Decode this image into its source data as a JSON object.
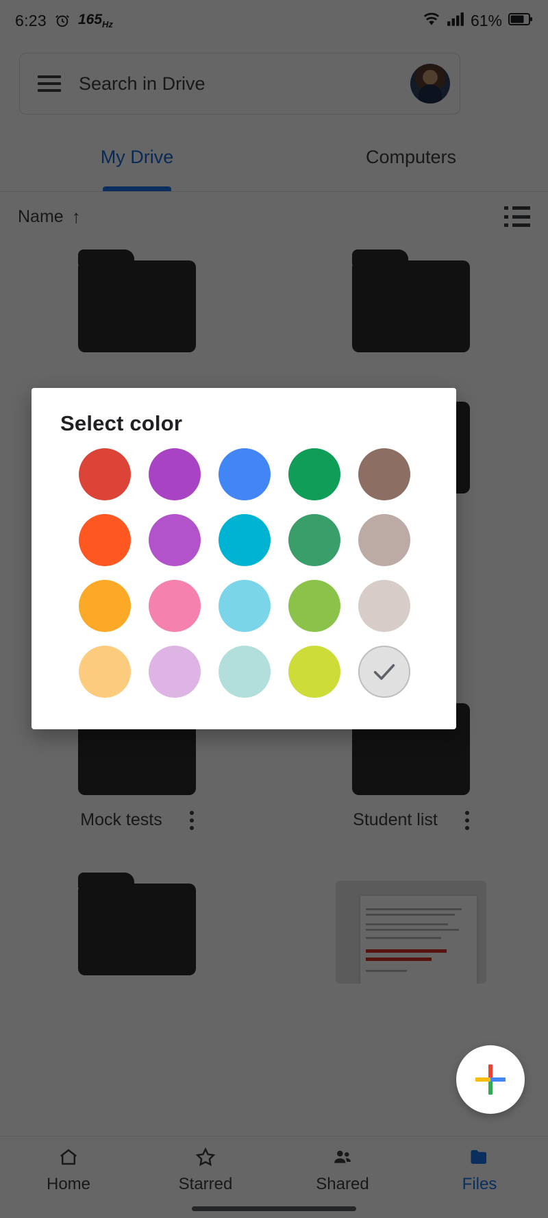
{
  "statusbar": {
    "time": "6:23",
    "refresh_rate": "165",
    "refresh_unit": "Hz",
    "battery_percent": "61%",
    "icons": [
      "alarm-icon",
      "wifi-icon",
      "signal-icon",
      "battery-icon"
    ]
  },
  "search": {
    "placeholder": "Search in Drive",
    "menu_icon": "hamburger-menu-icon",
    "avatar": "user-avatar"
  },
  "tabs": [
    {
      "label": "My Drive",
      "active": true
    },
    {
      "label": "Computers",
      "active": false
    }
  ],
  "sort": {
    "label": "Name",
    "direction_arrow": "↑",
    "view_toggle_icon": "list-view-icon"
  },
  "files": {
    "row2": [
      {
        "name": "Mock tests",
        "type": "folder"
      },
      {
        "name": "Student list",
        "type": "folder"
      }
    ]
  },
  "fab": {
    "label": "new-button",
    "icon": "google-plus-icon"
  },
  "bottomnav": [
    {
      "label": "Home",
      "icon": "home-icon",
      "active": false
    },
    {
      "label": "Starred",
      "icon": "star-icon",
      "active": false
    },
    {
      "label": "Shared",
      "icon": "people-icon",
      "active": false
    },
    {
      "label": "Files",
      "icon": "folder-icon",
      "active": true
    }
  ],
  "dialog": {
    "title": "Select color",
    "colors": [
      [
        {
          "name": "red",
          "hex": "#DB4437",
          "selected": false
        },
        {
          "name": "purple",
          "hex": "#A843C4",
          "selected": false
        },
        {
          "name": "blue",
          "hex": "#4285F4",
          "selected": false
        },
        {
          "name": "green",
          "hex": "#0F9D58",
          "selected": false
        },
        {
          "name": "brown",
          "hex": "#8D6E63",
          "selected": false
        }
      ],
      [
        {
          "name": "orange",
          "hex": "#FF5722",
          "selected": false
        },
        {
          "name": "light-purple",
          "hex": "#B253CC",
          "selected": false
        },
        {
          "name": "cyan",
          "hex": "#00B3D3",
          "selected": false
        },
        {
          "name": "medium-green",
          "hex": "#3A9E6A",
          "selected": false
        },
        {
          "name": "light-brown",
          "hex": "#BCAAA4",
          "selected": false
        }
      ],
      [
        {
          "name": "amber",
          "hex": "#FBA926",
          "selected": false
        },
        {
          "name": "pink",
          "hex": "#F582AE",
          "selected": false
        },
        {
          "name": "light-blue",
          "hex": "#7BD5E8",
          "selected": false
        },
        {
          "name": "light-green",
          "hex": "#8BC34A",
          "selected": false
        },
        {
          "name": "pale-brown",
          "hex": "#D7CCC8",
          "selected": false
        }
      ],
      [
        {
          "name": "pale-amber",
          "hex": "#FCCB7E",
          "selected": false
        },
        {
          "name": "lilac",
          "hex": "#DDB4E3",
          "selected": false
        },
        {
          "name": "pale-cyan",
          "hex": "#B2DFDB",
          "selected": false
        },
        {
          "name": "lime",
          "hex": "#CDDC39",
          "selected": false
        },
        {
          "name": "gray-selected",
          "hex": "#E0E0E0",
          "selected": true
        }
      ]
    ]
  }
}
